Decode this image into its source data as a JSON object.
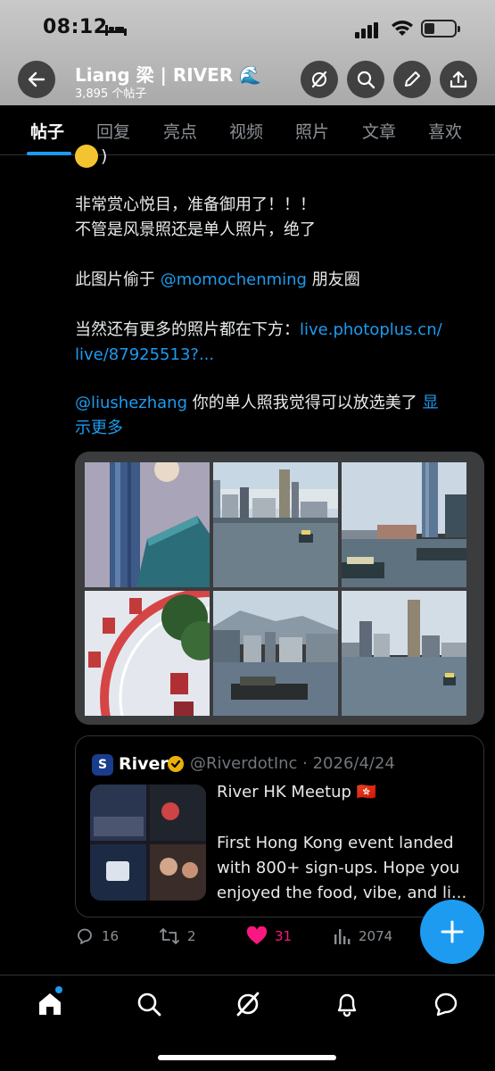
{
  "status_bar": {
    "time": "08:12"
  },
  "header": {
    "title": "Liang 梁 | RIVER 🌊",
    "subtitle": "3,895 个帖子"
  },
  "tabs": [
    {
      "label": "帖子",
      "active": true
    },
    {
      "label": "回复"
    },
    {
      "label": "亮点"
    },
    {
      "label": "视频"
    },
    {
      "label": "照片"
    },
    {
      "label": "文章"
    },
    {
      "label": "喜欢"
    }
  ],
  "post": {
    "paren": ")",
    "line1": "非常赏心悦目，准备御用了！！！",
    "line2": "不管是风景照还是单人照片，绝了",
    "line3_prefix": "此图片偷于 ",
    "line3_mention": "@momochenming",
    "line3_suffix": " 朋友圈",
    "line4_prefix": "当然还有更多的照片都在下方：",
    "line4_link": "live.photoplus.cn/",
    "line5_link": "live/87925513?...",
    "line6_mention": "@liushezhang",
    "line6_text": " 你的单人照我觉得可以放选美了 ",
    "line6_more": "显",
    "line7_more": "示更多"
  },
  "quote": {
    "logo_letter": "S",
    "name": "River",
    "handle": "@RiverdotInc · 2026/4/24",
    "title": "River HK Meetup 🇭🇰",
    "body": "First Hong Kong event landed with 800+ sign-ups. Hope you enjoyed the food, vibe, and li..."
  },
  "actions": {
    "replies": "16",
    "reposts": "2",
    "likes": "31",
    "views": "2074"
  },
  "colors": {
    "accent": "#1d9bf0",
    "like": "#f91880",
    "background": "#000000"
  }
}
